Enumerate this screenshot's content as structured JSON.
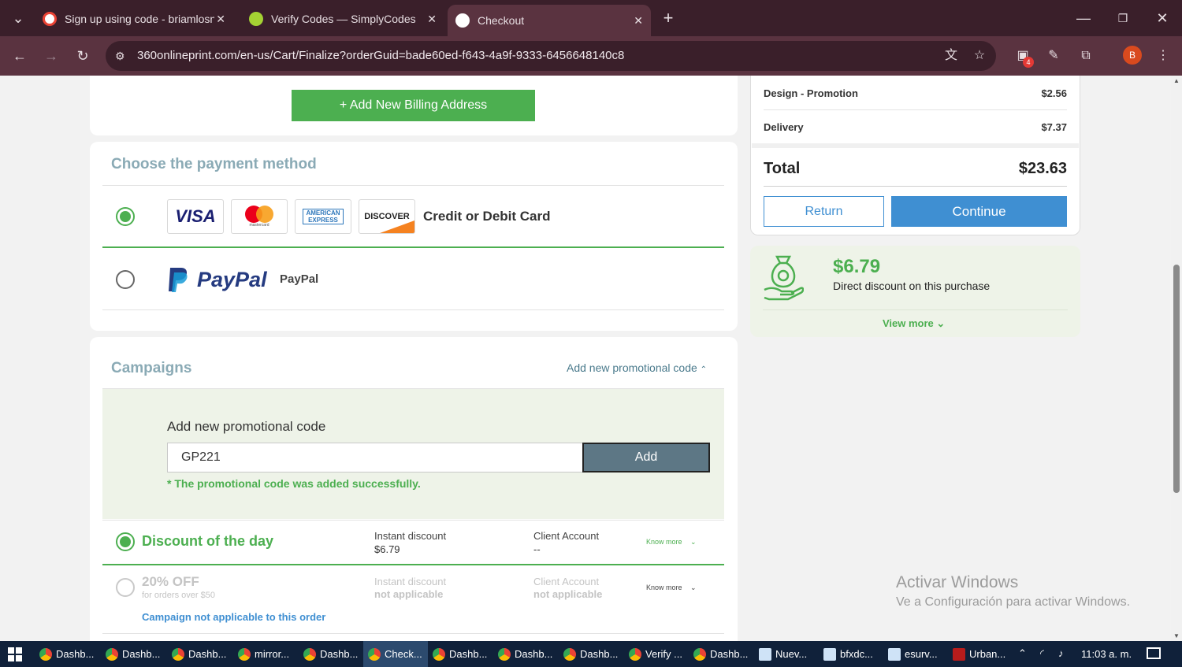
{
  "browser": {
    "tabs": [
      {
        "title": "Sign up using code - briamlosn",
        "favicon": "gmail-icon"
      },
      {
        "title": "Verify Codes — SimplyCodes",
        "favicon": "simplycodes-icon"
      },
      {
        "title": "Checkout",
        "favicon": "360-icon"
      }
    ],
    "new_tab": "+",
    "url": "360onlineprint.com/en-us/Cart/Finalize?orderGuid=bade60ed-f643-4a9f-9333-6456648140c8",
    "extension_badge": "4",
    "profile_initial": "B"
  },
  "billing": {
    "add_button": "+ Add New Billing Address"
  },
  "payment": {
    "title": "Choose the payment method",
    "card_label": "Credit or Debit Card",
    "card_logos": {
      "visa": "VISA",
      "amex": "AMERICAN EXPRESS",
      "discover": "DISCOVER",
      "mastercard": "mastercard"
    },
    "paypal_logo": "PayPal",
    "paypal_label": "PayPal"
  },
  "campaigns": {
    "title": "Campaigns",
    "add_link": "Add new promotional code",
    "promo_heading": "Add new promotional code",
    "promo_value": "GP221",
    "add_button": "Add",
    "success_msg": "* The promotional code was added successfully.",
    "rows": [
      {
        "name": "Discount of the day",
        "sub": "",
        "col1_label": "Instant discount",
        "col1_value": "$6.79",
        "col2_label": "Client Account",
        "col2_value": "--",
        "know_more": "Know more"
      },
      {
        "name": "20% OFF",
        "sub": "for orders over $50",
        "col1_label": "Instant discount",
        "col1_value": "not applicable",
        "col2_label": "Client Account",
        "col2_value": "not applicable",
        "know_more": "Know more",
        "note": "Campaign not applicable to this order"
      }
    ]
  },
  "summary": {
    "lines": [
      {
        "label": "Design - Promotion",
        "value": "$2.56"
      },
      {
        "label": "Delivery",
        "value": "$7.37"
      }
    ],
    "total_label": "Total",
    "total_value": "$23.63",
    "return_button": "Return",
    "continue_button": "Continue"
  },
  "discount": {
    "amount": "$6.79",
    "text": "Direct discount on this purchase",
    "view_more": "View more"
  },
  "watermark": {
    "title": "Activar Windows",
    "subtitle": "Ve a Configuración para activar Windows."
  },
  "taskbar": {
    "items": [
      "Dashb...",
      "Dashb...",
      "Dashb...",
      "mirror...",
      "Dashb...",
      "Check...",
      "Dashb...",
      "Dashb...",
      "Dashb...",
      "Verify ...",
      "Dashb...",
      "Nuev...",
      "bfxdc...",
      "esurv...",
      "Urban..."
    ],
    "clock": "11:03 a. m."
  },
  "colors": {
    "accent_green": "#4caf50",
    "accent_blue": "#3f8fd2",
    "title_gray": "#8aaab5"
  }
}
